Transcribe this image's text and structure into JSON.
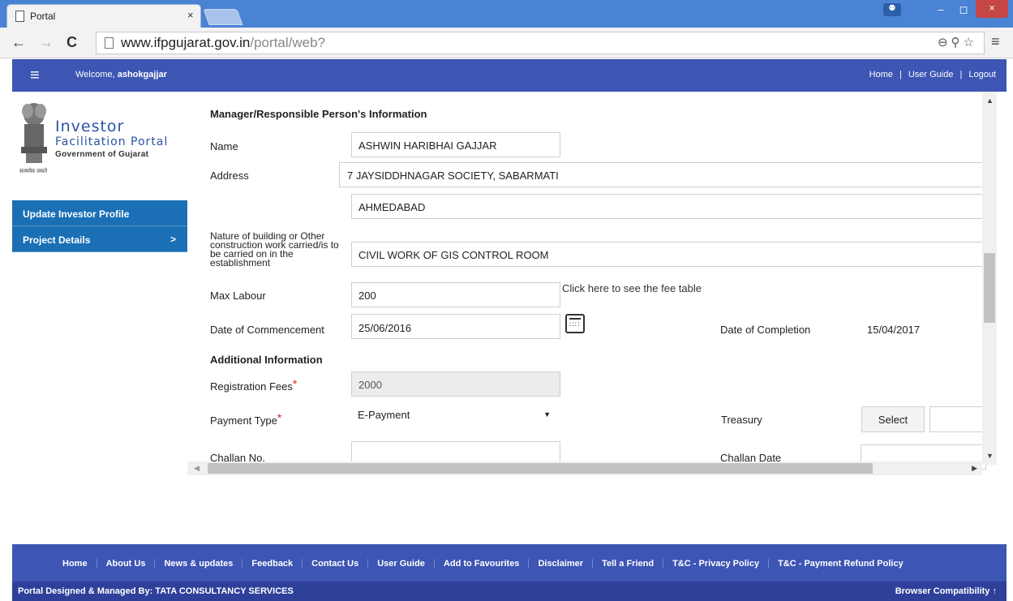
{
  "browser": {
    "tab_title": "Portal",
    "tab_close": "×",
    "url_host": "www.ifpgujarat.gov.in",
    "url_path": "/portal/web?",
    "window_controls": {
      "user": "⚉",
      "minimize": "–",
      "maximize": "◻",
      "close": "×"
    }
  },
  "header": {
    "welcome_prefix": "Welcome,",
    "username": "ashokgajjar",
    "links": {
      "home": "Home",
      "sep": "|",
      "user_guide": "User Guide",
      "logout": "Logout"
    }
  },
  "logo": {
    "investor": "Investor",
    "facilitation": "Facilitation Portal",
    "government": "Government of Gujarat",
    "motto": "सत्यमेव जयते"
  },
  "sidebar": {
    "items": [
      {
        "label": "Update Investor Profile"
      },
      {
        "label": "Project Details",
        "chevron": ">"
      }
    ]
  },
  "form": {
    "manager_section": "Manager/Responsible Person's Information",
    "name_label": "Name",
    "name_value": "ASHWIN HARIBHAI GAJJAR",
    "address_label": "Address",
    "address_line1": "7 JAYSIDDHNAGAR SOCIETY, SABARMATI",
    "address_line2": "AHMEDABAD",
    "nature_label": "Nature of building or Other construction work carried/is to be carried on in the establishment",
    "nature_value": "CIVIL WORK OF GIS CONTROL ROOM",
    "max_labour_label": "Max Labour",
    "max_labour_value": "200",
    "fee_table_link": "Click here to see the fee table",
    "commencement_label": "Date of Commencement",
    "commencement_value": "25/06/2016",
    "completion_label": "Date of Completion",
    "completion_value": "15/04/2017",
    "additional_section": "Additional Information",
    "reg_fees_label": "Registration Fees",
    "reg_fees_value": "2000",
    "payment_type_label": "Payment Type",
    "payment_type_value": "E-Payment",
    "treasury_label": "Treasury",
    "treasury_button": "Select",
    "challan_no_label": "Challan No.",
    "challan_no_value": "",
    "challan_date_label": "Challan Date",
    "challan_date_value": "",
    "required_mark": "*"
  },
  "footer": {
    "links": [
      "Home",
      "About Us",
      "News & updates",
      "Feedback",
      "Contact Us",
      "User Guide",
      "Add to Favourites",
      "Disclaimer",
      "Tell a Friend",
      "T&C - Privacy Policy",
      "T&C - Payment Refund Policy"
    ],
    "credit": "Portal Designed & Managed By: TATA CONSULTANCY SERVICES",
    "compat": "Browser Compatibility",
    "compat_icon": "↑"
  },
  "colors": {
    "header_blue": "#3d55b3",
    "sidebar_blue": "#1a6fb5",
    "footer_dark": "#2e409a",
    "required_red": "#e02020"
  }
}
